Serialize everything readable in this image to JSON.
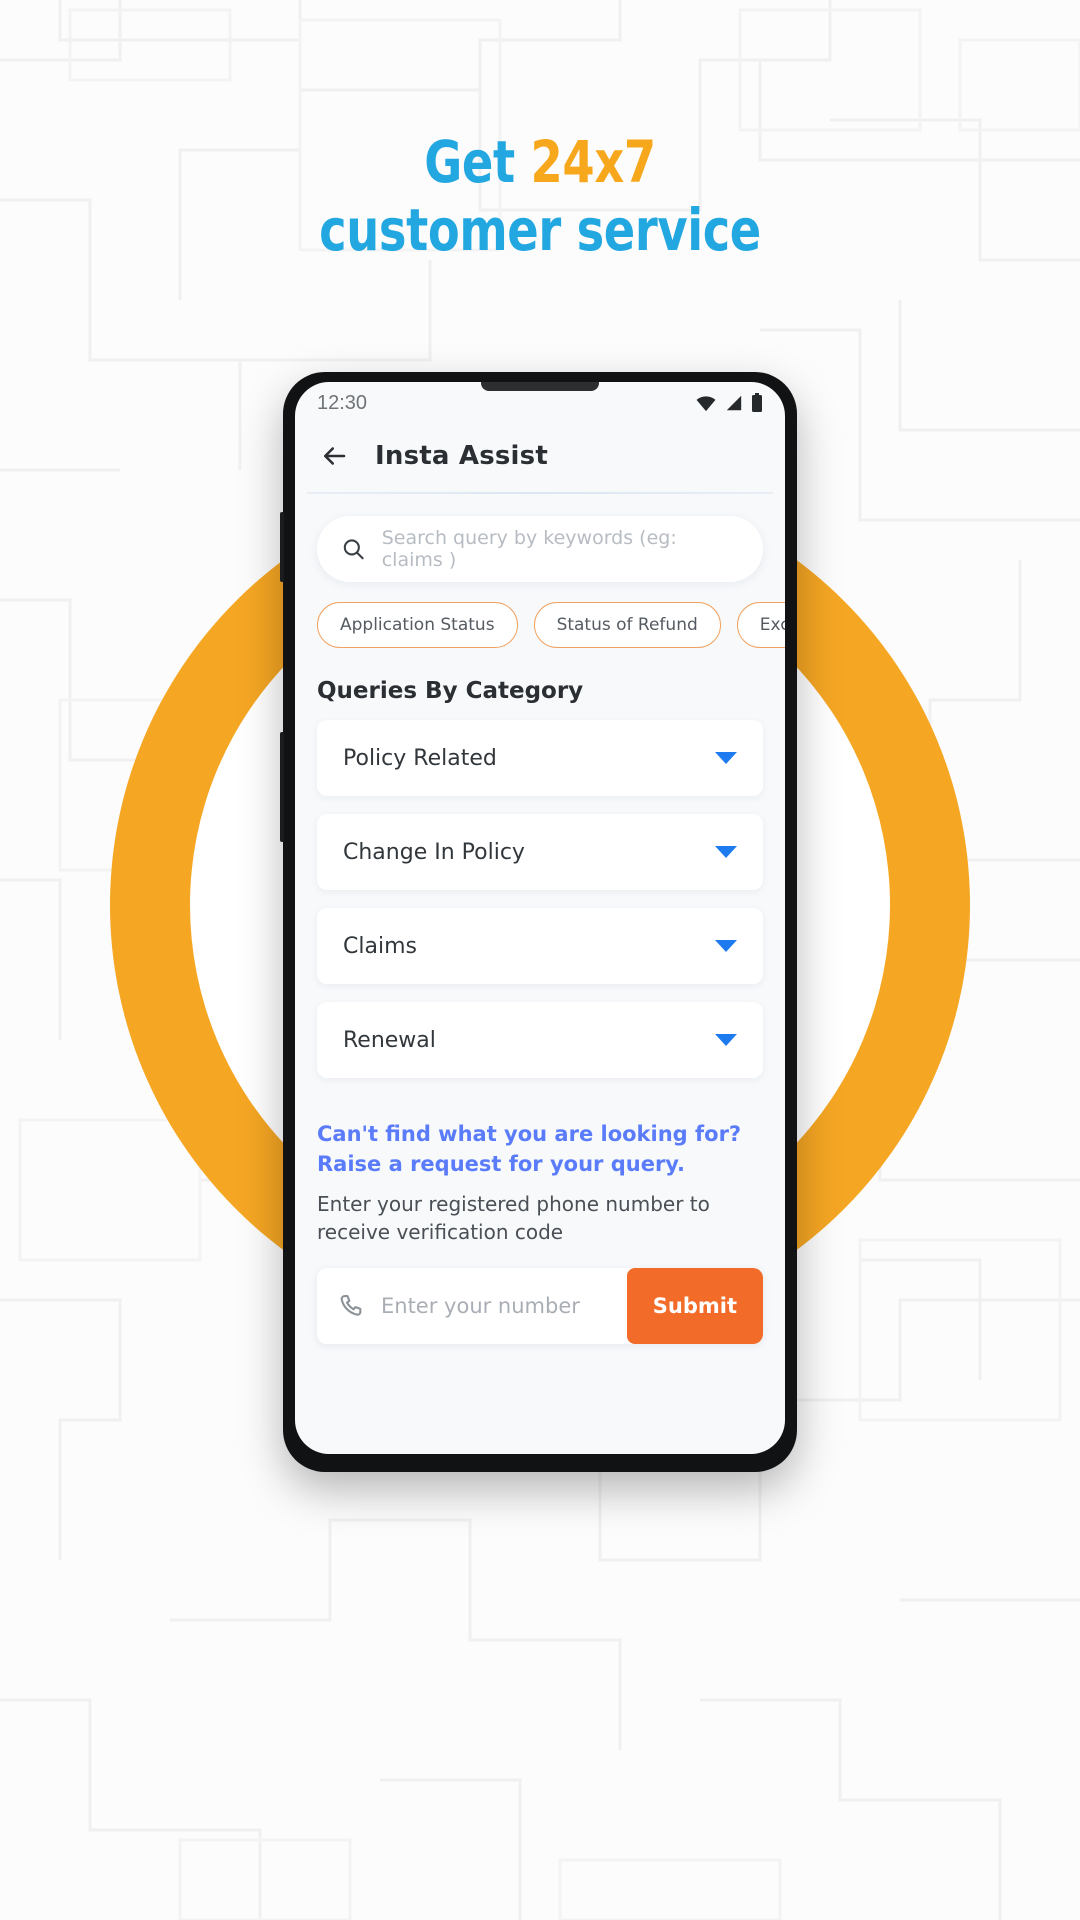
{
  "promo": {
    "line1_part1": "Get ",
    "line1_part2": "24x7",
    "line2": "customer service",
    "blue": "#22A7E0",
    "orange": "#F7A71B",
    "ring_color": "#F5A623"
  },
  "status_bar": {
    "time": "12:30",
    "icons": [
      "wifi-icon",
      "signal-icon",
      "battery-icon"
    ]
  },
  "header": {
    "back_icon": "back-arrow-icon",
    "title": "Insta Assist"
  },
  "search": {
    "icon": "search-icon",
    "placeholder": "Search query by keywords (eg: claims )",
    "value": ""
  },
  "chips": [
    {
      "label": "Application Status"
    },
    {
      "label": "Status of Refund"
    },
    {
      "label": "Excess Refund"
    }
  ],
  "categories": {
    "title": "Queries By Category",
    "items": [
      {
        "label": "Policy Related",
        "caret": "chevron-down-icon"
      },
      {
        "label": "Change In Policy",
        "caret": "chevron-down-icon"
      },
      {
        "label": "Claims",
        "caret": "chevron-down-icon"
      },
      {
        "label": "Renewal",
        "caret": "chevron-down-icon"
      }
    ]
  },
  "raise_request": {
    "link_text": "Can't find what you are looking for? Raise a request for your query.",
    "description": "Enter your registered phone number to receive verification code",
    "link_color": "#5B7CFA"
  },
  "phone_form": {
    "icon": "phone-call-icon",
    "placeholder": "Enter your number",
    "value": "",
    "submit_label": "Submit",
    "submit_color": "#F26B28"
  }
}
